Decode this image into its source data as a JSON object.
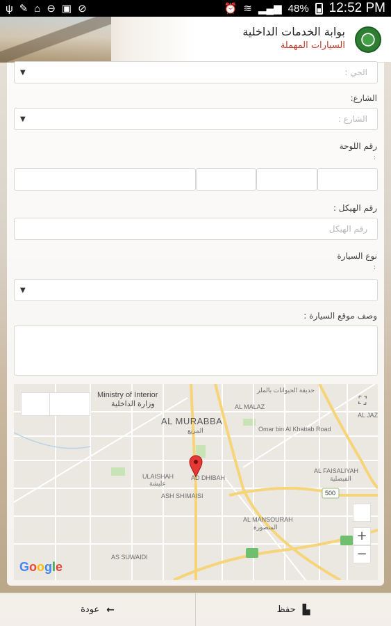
{
  "status_bar": {
    "battery": "48%",
    "time": "12:52 PM"
  },
  "header": {
    "title": "بوابة الخدمات الداخلية",
    "subtitle": "السيارات المهملة"
  },
  "form": {
    "district": {
      "placeholder": "الحي :"
    },
    "street": {
      "label": "الشارع:",
      "placeholder": "الشارع :"
    },
    "plate": {
      "label": "رقم اللوحة",
      "colon": ":"
    },
    "chassis": {
      "label": "رقم الهيكل :",
      "placeholder": "رقم الهيكل"
    },
    "car_type": {
      "label": "نوع السيارة",
      "colon": ":"
    },
    "location_desc": {
      "label": "وصف موقع السيارة :"
    }
  },
  "map": {
    "labels": {
      "ministry_en": "Ministry of Interior",
      "ministry_ar": "وزارة الداخلية",
      "zoo": "حديقة الحيوانات بالملز",
      "al_murabba_en": "AL MURABBA",
      "al_murabba_ar": "المربع",
      "al_malaz": "AL MALAZ",
      "ulaishah_en": "ULAISHAH",
      "ulaishah_ar": "عليشة",
      "ash_shimaisi": "ASH SHIMAISI",
      "al_faisaliyah_en": "AL FAISALIYAH",
      "al_faisaliyah_ar": "الفيصلية",
      "al_mansourah_en": "AL MANSOURAH",
      "al_mansourah_ar": "المنصورة",
      "as_sulaimi": "AS SUWAIDI",
      "al_dhibah": "AD DHIBAH",
      "route_500": "500",
      "khattab": "Omar bin Al Khattab Road",
      "al_jazi": "AL JAZI"
    },
    "zoom_in": "+",
    "zoom_out": "−",
    "fullscreen_icon": "fullscreen-icon",
    "google": "Google"
  },
  "bottom_bar": {
    "save_label": "حفظ",
    "back_label": "عودة"
  }
}
